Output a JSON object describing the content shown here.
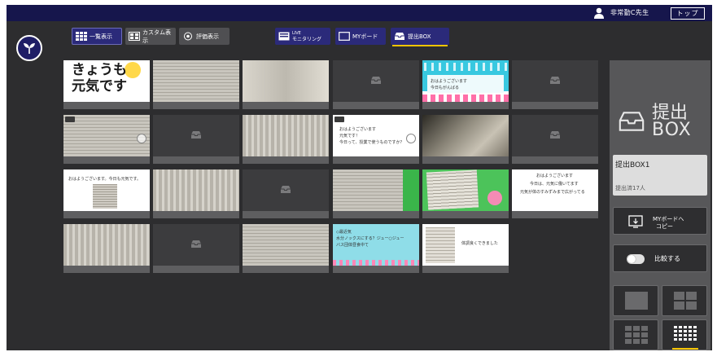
{
  "header": {
    "user_name": "非常勤C先生",
    "top_button_label": "トップ"
  },
  "view_modes": {
    "list_label": "一覧表示",
    "custom_label": "カスタム表示",
    "eval_label": "評価表示"
  },
  "sections": {
    "live_label_1": "LIVE",
    "live_label_2": "モニタリング",
    "myboard_label": "MYボード",
    "teishutsu_label": "提出BOX"
  },
  "cards": {
    "c1_text": "きょうも元気です",
    "c5_line1": "おはようございます",
    "c5_line2": "今日もがんばる",
    "c8_line1": "おはようございます",
    "c8_line2": "元気です！",
    "c8_line3": "今日って、授業で使うものですか？",
    "c13_line1": "おはようございます。今日も元気です。",
    "c18_line1": "おはようございます",
    "c18_line2": "今日は、元気に働いてます",
    "c18_line3": "元気が体のすみずみまで広がってる",
    "c22_line1": "◇最近気",
    "c22_line2": "水分ノックスにする？ジュー○ジュー",
    "c22_line3": "バス団体昼食中て",
    "c23_line1": "体調良くできました"
  },
  "panel": {
    "title_line1": "提出",
    "title_line2": "BOX",
    "box_name": "提出BOX1",
    "box_count": "提出済17人",
    "copy_label_1": "MYボードへ",
    "copy_label_2": "コピー",
    "compare_label": "比較する"
  },
  "colors": {
    "frame_bg": "#2d2d2f",
    "topbar_bg": "#16164c",
    "accent_navy": "#2b2a7a",
    "active_underline": "#f5c400"
  },
  "icons": {
    "user": "user-icon",
    "logo": "sprout-logo-icon",
    "grid": "grid-icon",
    "inbox": "inbox-icon"
  }
}
